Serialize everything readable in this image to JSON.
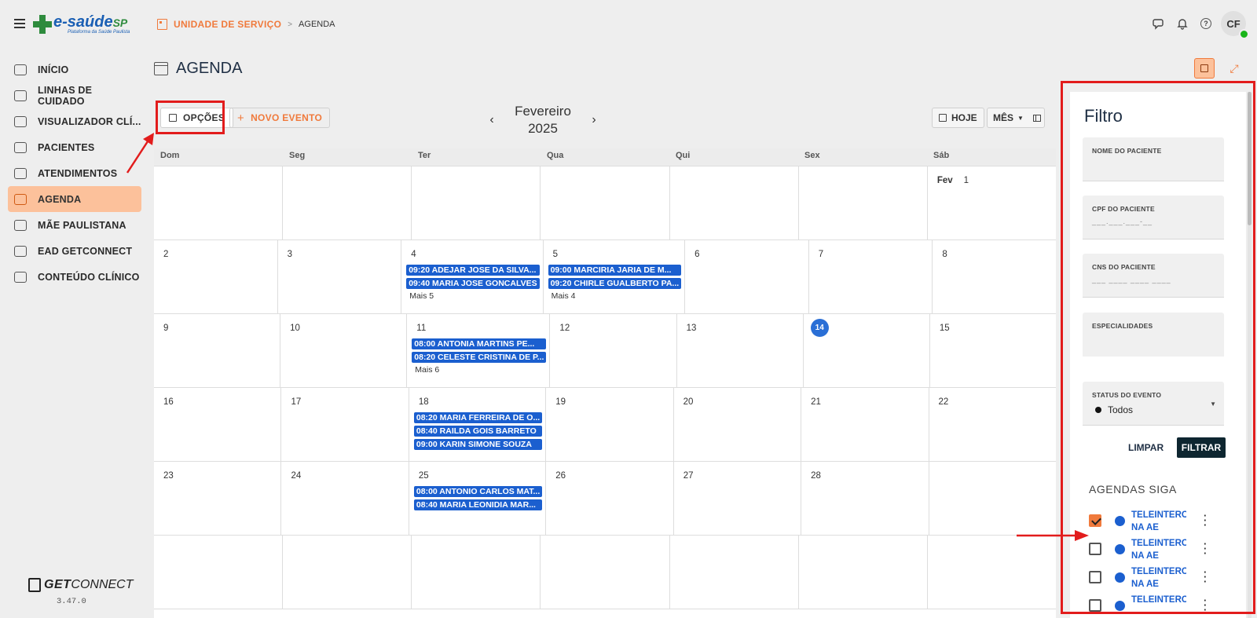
{
  "logo": {
    "brand": "e-saúde",
    "brand_suffix": "SP",
    "subtitle": "Plataforma da Saúde Paulista"
  },
  "breadcrumb": {
    "root": "UNIDADE DE SERVIÇO",
    "separator": ">",
    "current": "AGENDA"
  },
  "user": {
    "initials": "CF"
  },
  "sidebar": {
    "items": [
      {
        "label": "INÍCIO",
        "icon": "home-icon"
      },
      {
        "label": "LINHAS DE CUIDADO",
        "icon": "hand-heart-icon"
      },
      {
        "label": "VISUALIZADOR CLÍ...",
        "icon": "clipboard-icon"
      },
      {
        "label": "PACIENTES",
        "icon": "users-icon"
      },
      {
        "label": "ATENDIMENTOS",
        "icon": "clipboard-plus-icon"
      },
      {
        "label": "AGENDA",
        "icon": "calendar-icon",
        "active": true
      },
      {
        "label": "MÃE PAULISTANA",
        "icon": "mother-icon"
      },
      {
        "label": "EAD GETCONNECT",
        "icon": "course-icon"
      },
      {
        "label": "CONTEÚDO CLÍNICO",
        "icon": "book-icon"
      }
    ]
  },
  "footer": {
    "brand_bold": "GET",
    "brand_rest": "CONNECT",
    "version": "3.47.0"
  },
  "page": {
    "title": "AGENDA"
  },
  "toolbar": {
    "options_label": "OPÇÕES",
    "new_event_label": "NOVO EVENTO",
    "month": "Fevereiro",
    "year": "2025",
    "prev": "‹",
    "next": "›",
    "today_label": "HOJE",
    "view_label": "MÊS"
  },
  "calendar": {
    "weekdays": [
      "Dom",
      "Seg",
      "Ter",
      "Qua",
      "Qui",
      "Sex",
      "Sáb"
    ],
    "weeks": [
      [
        {
          "d": ""
        },
        {
          "d": ""
        },
        {
          "d": ""
        },
        {
          "d": ""
        },
        {
          "d": ""
        },
        {
          "d": ""
        },
        {
          "d": "1",
          "prefix": "Fev"
        }
      ],
      [
        {
          "d": "2"
        },
        {
          "d": "3"
        },
        {
          "d": "4",
          "events": [
            "09:20 ADEJAR JOSE DA SILVA...",
            "09:40 MARIA JOSE GONCALVES"
          ],
          "more": "Mais 5"
        },
        {
          "d": "5",
          "events": [
            "09:00 MARCIRIA JARIA DE M...",
            "09:20 CHIRLE GUALBERTO PA..."
          ],
          "more": "Mais 4"
        },
        {
          "d": "6"
        },
        {
          "d": "7"
        },
        {
          "d": "8"
        }
      ],
      [
        {
          "d": "9"
        },
        {
          "d": "10"
        },
        {
          "d": "11",
          "events": [
            "08:00 ANTONIA MARTINS PE...",
            "08:20 CELESTE CRISTINA DE P..."
          ],
          "more": "Mais 6"
        },
        {
          "d": "12"
        },
        {
          "d": "13"
        },
        {
          "d": "14",
          "today": true
        },
        {
          "d": "15"
        }
      ],
      [
        {
          "d": "16"
        },
        {
          "d": "17"
        },
        {
          "d": "18",
          "events": [
            "08:20 MARIA FERREIRA DE O...",
            "08:40 RAILDA GOIS BARRETO",
            "09:00 KARIN SIMONE SOUZA"
          ]
        },
        {
          "d": "19"
        },
        {
          "d": "20"
        },
        {
          "d": "21"
        },
        {
          "d": "22"
        }
      ],
      [
        {
          "d": "23"
        },
        {
          "d": "24"
        },
        {
          "d": "25",
          "events": [
            "08:00 ANTONIO CARLOS MAT...",
            "08:40 MARIA LEONIDIA MAR..."
          ]
        },
        {
          "d": "26"
        },
        {
          "d": "27"
        },
        {
          "d": "28"
        },
        {
          "d": ""
        }
      ],
      [
        {
          "d": ""
        },
        {
          "d": ""
        },
        {
          "d": ""
        },
        {
          "d": ""
        },
        {
          "d": ""
        },
        {
          "d": ""
        },
        {
          "d": ""
        }
      ]
    ]
  },
  "filter": {
    "title": "Filtro",
    "patient_name_label": "NOME DO PACIENTE",
    "cpf_label": "CPF DO PACIENTE",
    "cpf_mask": "___.___.___-__",
    "cns_label": "CNS DO PACIENTE",
    "cns_mask": "___ ____ ____ ____",
    "specialties_label": "ESPECIALIDADES",
    "status_label": "STATUS DO EVENTO",
    "status_value": "Todos",
    "clear_label": "LIMPAR",
    "apply_label": "FILTRAR",
    "agendas_title": "AGENDAS SIGA",
    "agendas": [
      {
        "line1": "TELEINTERCO",
        "line2": "NA AE",
        "checked": true
      },
      {
        "line1": "TELEINTERCO",
        "line2": "NA AE",
        "checked": false
      },
      {
        "line1": "TELEINTERCO",
        "line2": "NA AE",
        "checked": false
      },
      {
        "line1": "TELEINTERCO",
        "line2": "",
        "checked": false
      }
    ]
  },
  "colors": {
    "accent": "#f07a3c",
    "event": "#1b5fcf",
    "highlight": "#e21c1c",
    "active_nav": "#fcc19b"
  }
}
